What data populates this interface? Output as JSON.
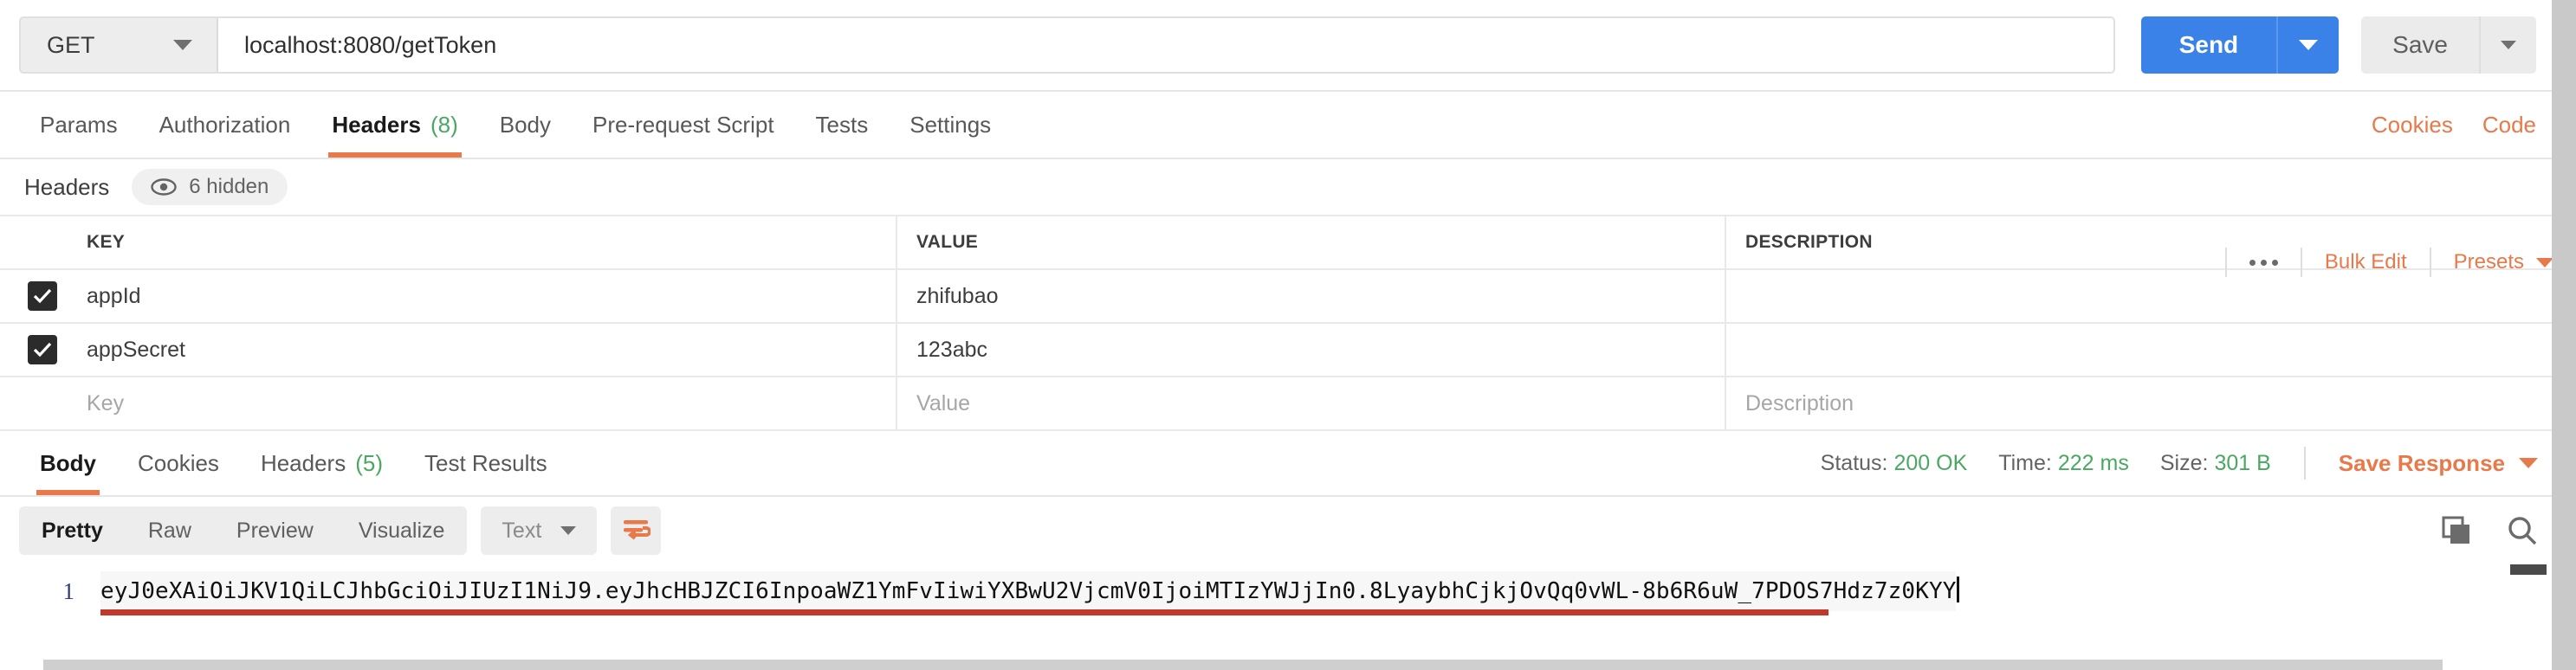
{
  "request": {
    "method": "GET",
    "url": "localhost:8080/getToken",
    "send_label": "Send",
    "save_label": "Save",
    "tabs": [
      {
        "label": "Params",
        "count": "",
        "active": false
      },
      {
        "label": "Authorization",
        "count": "",
        "active": false
      },
      {
        "label": "Headers",
        "count": "(8)",
        "active": true
      },
      {
        "label": "Body",
        "count": "",
        "active": false
      },
      {
        "label": "Pre-request Script",
        "count": "",
        "active": false
      },
      {
        "label": "Tests",
        "count": "",
        "active": false
      },
      {
        "label": "Settings",
        "count": "",
        "active": false
      }
    ],
    "cookies_link": "Cookies",
    "code_link": "Code"
  },
  "headers_section": {
    "title": "Headers",
    "hidden_label": "6 hidden",
    "columns": [
      "KEY",
      "VALUE",
      "DESCRIPTION"
    ],
    "bulk_edit": "Bulk Edit",
    "presets": "Presets",
    "rows": [
      {
        "checked": true,
        "key": "appId",
        "value": "zhifubao",
        "description": ""
      },
      {
        "checked": true,
        "key": "appSecret",
        "value": "123abc",
        "description": ""
      }
    ],
    "placeholder_row": {
      "key": "Key",
      "value": "Value",
      "description": "Description"
    }
  },
  "response": {
    "tabs": [
      {
        "label": "Body",
        "count": "",
        "active": true
      },
      {
        "label": "Cookies",
        "count": "",
        "active": false
      },
      {
        "label": "Headers",
        "count": "(5)",
        "active": false
      },
      {
        "label": "Test Results",
        "count": "",
        "active": false
      }
    ],
    "status_label": "Status:",
    "status_value": "200 OK",
    "time_label": "Time:",
    "time_value": "222 ms",
    "size_label": "Size:",
    "size_value": "301 B",
    "save_response": "Save Response",
    "view_modes": [
      {
        "label": "Pretty",
        "active": true
      },
      {
        "label": "Raw",
        "active": false
      },
      {
        "label": "Preview",
        "active": false
      },
      {
        "label": "Visualize",
        "active": false
      }
    ],
    "format": "Text",
    "line_number": "1",
    "body_text": "eyJ0eXAiOiJKV1QiLCJhbGciOiJIUzI1NiJ9.eyJhcHBJZCI6InpoaWZ1YmFvIiwiYXBwU2VjcmV0IjoiMTIzYWJjIn0.8LyaybhCjkjOvQq0vWL-8b6R6uW_7PDOS7Hdz7z0KYY"
  },
  "colors": {
    "send_blue": "#3b82e8",
    "accent_orange": "#e8794a",
    "success_green": "#4aa863",
    "error_red": "#c0392b"
  }
}
